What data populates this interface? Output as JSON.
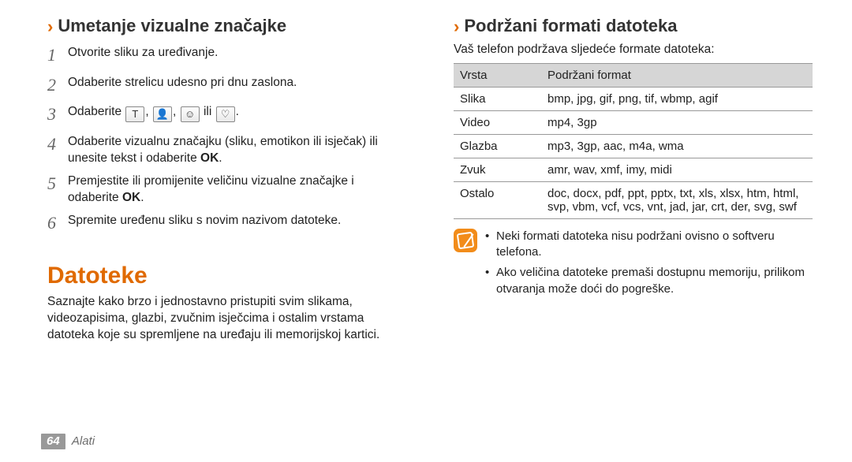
{
  "left": {
    "heading1": "Umetanje vizualne značajke",
    "steps": [
      "Otvorite sliku za uređivanje.",
      "Odaberite strelicu udesno pri dnu zaslona.",
      "__ICONLINE__",
      "Odaberite vizualnu značajku (sliku, emotikon ili isječak) ili unesite tekst i odaberite ",
      "Premjestite ili promijenite veličinu vizualne značajke i odaberite ",
      "Spremite uređenu sliku s novim nazivom datoteke."
    ],
    "step3_prefix": "Odaberite ",
    "step3_sep": ", ",
    "step3_or": " ili ",
    "step3_end": ".",
    "step_ok": "OK",
    "step_ok_end": ".",
    "heading2": "Datoteke",
    "body1": "Saznajte kako brzo i jednostavno pristupiti svim slikama, videozapisima, glazbi, zvučnim isječcima i ostalim vrstama datoteka koje su spremljene na uređaju ili memorijskoj kartici."
  },
  "right": {
    "heading": "Podržani formati datoteka",
    "intro": "Vaš telefon podržava sljedeće formate datoteka:",
    "th1": "Vrsta",
    "th2": "Podržani format",
    "rows": [
      {
        "k": "Slika",
        "v": "bmp, jpg, gif, png, tif, wbmp, agif"
      },
      {
        "k": "Video",
        "v": "mp4, 3gp"
      },
      {
        "k": "Glazba",
        "v": "mp3, 3gp, aac, m4a, wma"
      },
      {
        "k": "Zvuk",
        "v": "amr, wav, xmf, imy, midi"
      },
      {
        "k": "Ostalo",
        "v": "doc, docx, pdf, ppt, pptx, txt, xls, xlsx, htm, html, svp, vbm, vcf, vcs, vnt, jad, jar, crt, der, svg, swf"
      }
    ],
    "notes": [
      "Neki formati datoteka nisu podržani ovisno o softveru telefona.",
      "Ako veličina datoteke premaši dostupnu memoriju, prilikom otvaranja može doći do pogreške."
    ]
  },
  "icons": [
    "T",
    "👤",
    "☺",
    "♡"
  ],
  "footer": {
    "page": "64",
    "section": "Alati"
  }
}
